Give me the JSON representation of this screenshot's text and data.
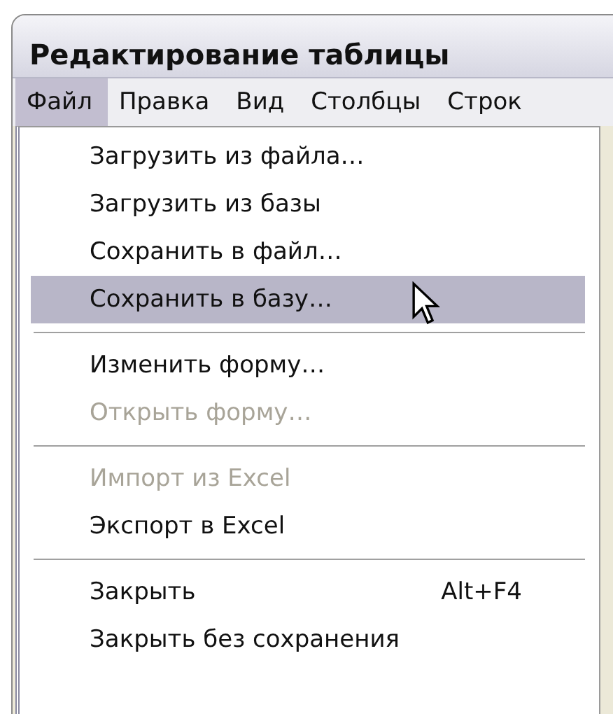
{
  "window": {
    "title": "Редактирование таблицы"
  },
  "menubar": [
    {
      "label": "Файл",
      "selected": true
    },
    {
      "label": "Правка",
      "selected": false
    },
    {
      "label": "Вид",
      "selected": false
    },
    {
      "label": "Столбцы",
      "selected": false
    },
    {
      "label": "Строк",
      "selected": false
    }
  ],
  "menu": [
    {
      "kind": "item",
      "label": "Загрузить из файла…",
      "disabled": false,
      "selected": false
    },
    {
      "kind": "item",
      "label": "Загрузить из базы",
      "disabled": false,
      "selected": false
    },
    {
      "kind": "item",
      "label": "Сохранить в файл…",
      "disabled": false,
      "selected": false
    },
    {
      "kind": "item",
      "label": "Сохранить в базу…",
      "disabled": false,
      "selected": true
    },
    {
      "kind": "separator"
    },
    {
      "kind": "item",
      "label": "Изменить форму…",
      "disabled": false,
      "selected": false
    },
    {
      "kind": "item",
      "label": "Открыть форму…",
      "disabled": true,
      "selected": false
    },
    {
      "kind": "separator"
    },
    {
      "kind": "item",
      "label": "Импорт из Excel",
      "disabled": true,
      "selected": false
    },
    {
      "kind": "item",
      "label": "Экспорт в Excel",
      "disabled": false,
      "selected": false
    },
    {
      "kind": "separator"
    },
    {
      "kind": "item",
      "label": "Закрыть",
      "shortcut": "Alt+F4",
      "disabled": false,
      "selected": false
    },
    {
      "kind": "item",
      "label": "Закрыть без сохранения",
      "disabled": false,
      "selected": false
    }
  ]
}
